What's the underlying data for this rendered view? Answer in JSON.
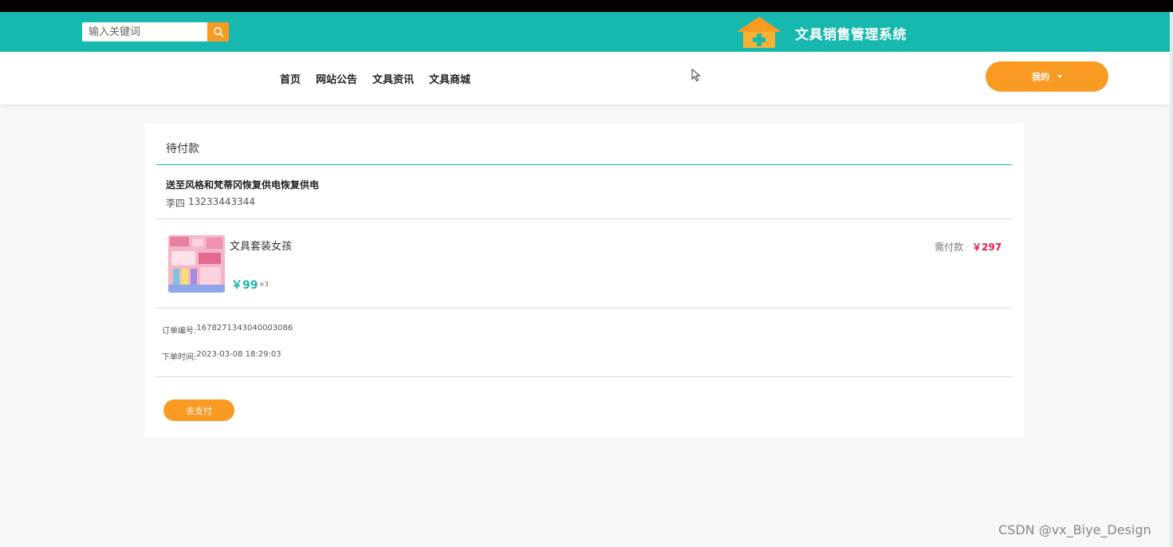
{
  "header": {
    "search_placeholder": "输入关键词",
    "site_title": "文具销售管理系统"
  },
  "nav": {
    "items": [
      {
        "label": "首页"
      },
      {
        "label": "网站公告"
      },
      {
        "label": "文具资讯"
      },
      {
        "label": "文具商城"
      }
    ],
    "me_label": "我的"
  },
  "order": {
    "status_title": "待付款",
    "address": "送至风格和梵蒂冈恢复供电恢复供电",
    "receiver_name": "李四",
    "receiver_phone": "13233443344",
    "product": {
      "name": "文具套装女孩",
      "price": "￥99",
      "quantity": "×3"
    },
    "need_pay_label": "需付款",
    "need_pay_amount": "￥297",
    "order_no_label": "订单编号:",
    "order_no": "1678271343040003086",
    "order_time_label": "下单时间:",
    "order_time": "2023-03-08 18:29:03",
    "pay_button": "去支付"
  },
  "watermark": "CSDN @vx_Biye_Design",
  "colors": {
    "teal": "#17b9ae",
    "orange": "#f99a22",
    "price_red": "#e0184d"
  }
}
